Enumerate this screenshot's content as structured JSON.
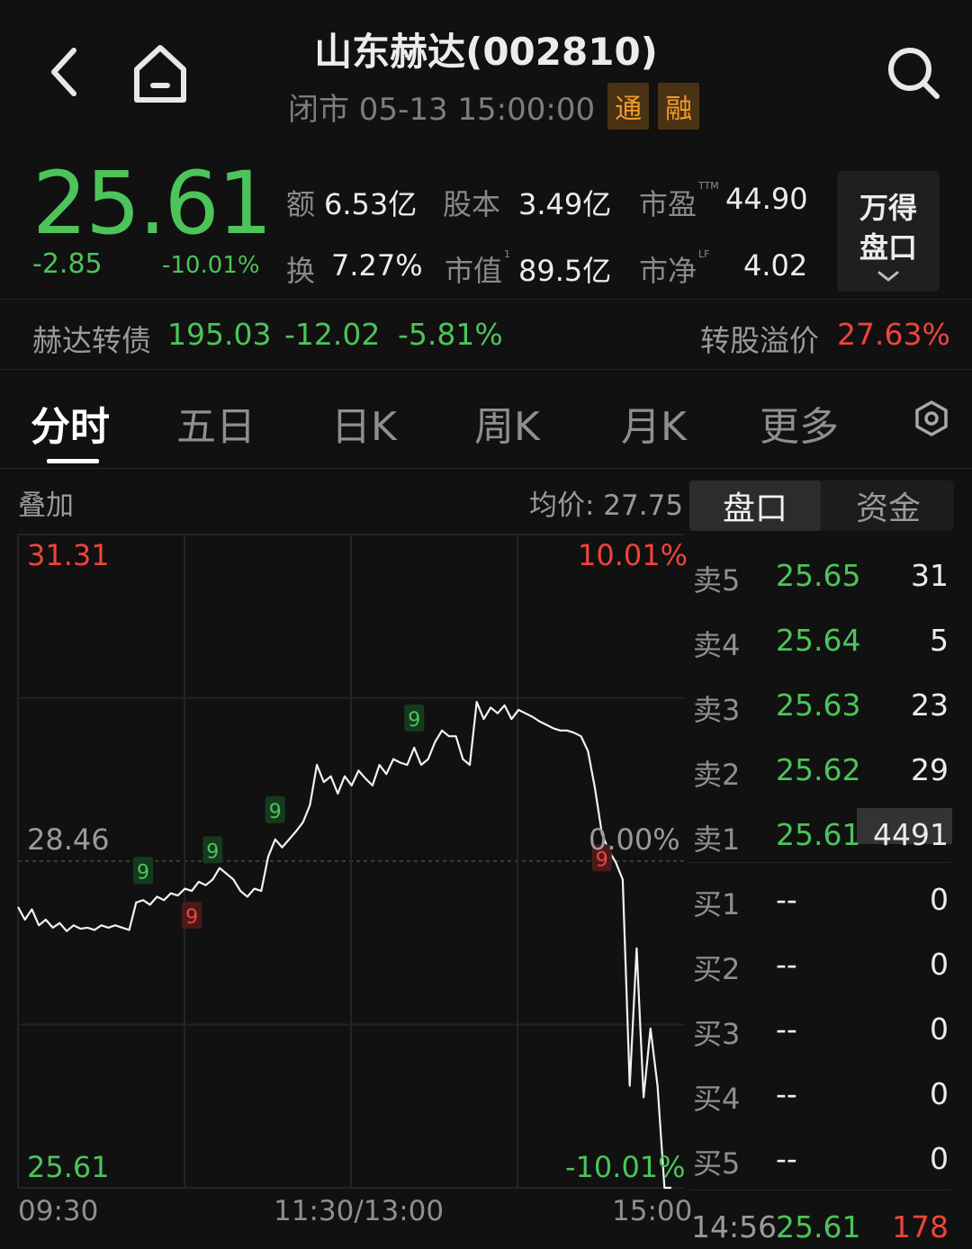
{
  "header": {
    "title": "山东赫达(002810)",
    "status_text": "闭市 05-13 15:00:00",
    "tags": [
      "通",
      "融"
    ]
  },
  "quote": {
    "price": "25.61",
    "change": "-2.85",
    "change_pct": "-10.01%",
    "stats": {
      "amount_label": "额",
      "amount_value": "6.53亿",
      "turnover_label": "换",
      "turnover_value": "7.27%",
      "capital_label": "股本",
      "capital_value": "3.49亿",
      "mktcap_label": "市值",
      "mktcap_sup": "1",
      "mktcap_value": "89.5亿",
      "pe_label": "市盈",
      "pe_sup": "TTM",
      "pe_value": "44.90",
      "pb_label": "市净",
      "pb_sup": "LF",
      "pb_value": "4.02"
    },
    "wind_button": {
      "line1": "万得",
      "line2": "盘口",
      "chevron": "⌄"
    }
  },
  "bond": {
    "name": "赫达转债",
    "price": "195.03",
    "change": "-12.02",
    "change_pct": "-5.81%",
    "premium_label": "转股溢价",
    "premium_value": "27.63%"
  },
  "tabs": [
    "分时",
    "五日",
    "日K",
    "周K",
    "月K",
    "更多"
  ],
  "active_tab": 0,
  "chart": {
    "overlay_label": "叠加",
    "avg_label": "均价: 27.75",
    "price_max": "31.31",
    "price_mid": "28.46",
    "price_min": "25.61",
    "pct_max": "10.01%",
    "pct_mid": "0.00%",
    "pct_min": "-10.01%",
    "times": [
      "09:30",
      "11:30/13:00",
      "15:00"
    ]
  },
  "chart_data": {
    "type": "line",
    "title": "",
    "xlabel": "",
    "ylabel": "",
    "x_ticks": [
      "09:30",
      "11:30/13:00",
      "15:00"
    ],
    "ylim": [
      25.61,
      31.31
    ],
    "reference_price": 28.46,
    "grid": true,
    "series": [
      {
        "values": [
          28.06,
          27.95,
          28.04,
          27.9,
          27.95,
          27.88,
          27.92,
          27.85,
          27.9,
          27.87,
          27.88,
          27.86,
          27.9,
          27.88,
          27.9,
          27.88,
          27.86,
          28.1,
          28.12,
          28.08,
          28.15,
          28.12,
          28.18,
          28.16,
          28.22,
          28.2,
          28.28,
          28.25,
          28.3,
          28.4,
          28.35,
          28.3,
          28.2,
          28.15,
          28.22,
          28.2,
          28.5,
          28.65,
          28.58,
          28.65,
          28.72,
          28.8,
          28.95,
          29.3,
          29.15,
          29.2,
          29.05,
          29.2,
          29.12,
          29.25,
          29.18,
          29.12,
          29.3,
          29.22,
          29.35,
          29.32,
          29.3,
          29.45,
          29.3,
          29.35,
          29.5,
          29.6,
          29.55,
          29.55,
          29.35,
          29.3,
          29.85,
          29.7,
          29.8,
          29.75,
          29.82,
          29.7,
          29.78,
          29.75,
          29.72,
          29.68,
          29.65,
          29.62,
          29.6,
          29.6,
          29.58,
          29.55,
          29.42,
          29.1,
          28.7,
          28.55,
          28.45,
          28.3,
          26.5,
          27.7,
          26.4,
          27.0,
          26.5,
          25.61,
          25.61
        ]
      }
    ],
    "markers": [
      {
        "label": "9",
        "color": "green"
      },
      {
        "label": "9",
        "color": "red"
      },
      {
        "label": "9",
        "color": "green"
      },
      {
        "label": "9",
        "color": "green"
      },
      {
        "label": "9",
        "color": "green"
      },
      {
        "label": "9",
        "color": "red"
      }
    ]
  },
  "panel": {
    "tabs": [
      "盘口",
      "资金"
    ],
    "active_tab": 0,
    "asks": [
      {
        "label": "卖5",
        "price": "25.65",
        "volume": "31"
      },
      {
        "label": "卖4",
        "price": "25.64",
        "volume": "5"
      },
      {
        "label": "卖3",
        "price": "25.63",
        "volume": "23"
      },
      {
        "label": "卖2",
        "price": "25.62",
        "volume": "29"
      },
      {
        "label": "卖1",
        "price": "25.61",
        "volume": "4491"
      }
    ],
    "bids": [
      {
        "label": "买1",
        "price": "--",
        "volume": "0"
      },
      {
        "label": "买2",
        "price": "--",
        "volume": "0"
      },
      {
        "label": "买3",
        "price": "--",
        "volume": "0"
      },
      {
        "label": "买4",
        "price": "--",
        "volume": "0"
      },
      {
        "label": "买5",
        "price": "--",
        "volume": "0"
      }
    ],
    "last_tick": {
      "time": "14:56",
      "price": "25.61",
      "volume": "178"
    }
  },
  "icons": {
    "back": "back-arrow-icon",
    "home": "home-icon",
    "search": "search-icon",
    "settings": "settings-icon"
  },
  "colors": {
    "up": "#f0433a",
    "down": "#4cc45a",
    "background": "#111111",
    "tag_bg": "#4a3214",
    "tag_fg": "#f39a2b"
  }
}
